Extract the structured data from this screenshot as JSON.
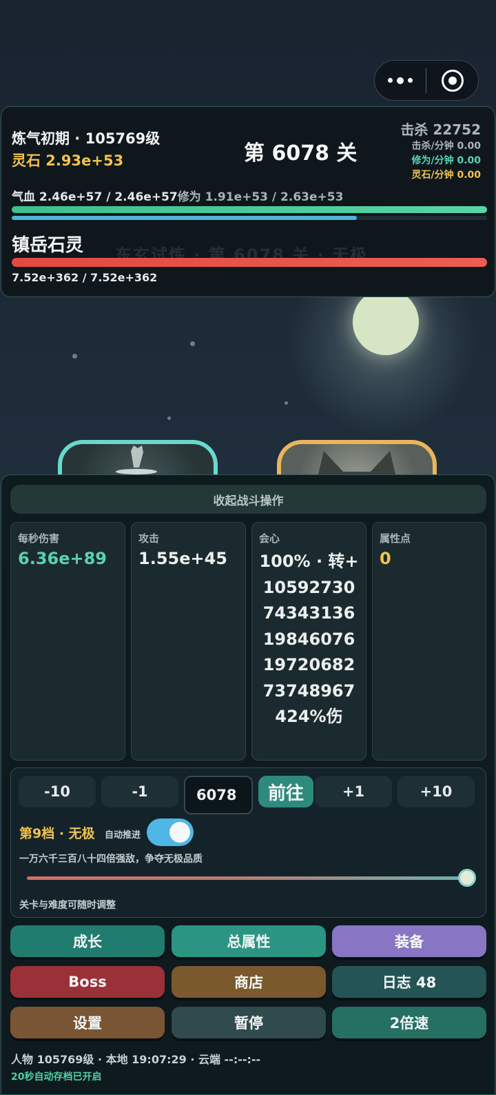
{
  "player": {
    "realm": "炼气初期 · 105769级",
    "stones": "灵石 2.93e+53",
    "hp_label": "气血 2.46e+57 / 2.46e+57",
    "cultivation_label": "修为 1.91e+53 / 2.63e+53",
    "hp_fraction": 1.0,
    "cultivation_fraction": 0.726
  },
  "stage": {
    "title": "第 6078 关"
  },
  "stats_header": {
    "kills": "击杀 22752",
    "kills_per_min": "击杀/分钟 0.00",
    "cultivation_per_min": "修为/分钟 0.00",
    "stones_per_min": "灵石/分钟 0.00"
  },
  "enemy": {
    "name": "镇岳石灵",
    "hp_label": "7.52e+362 / 7.52e+362",
    "hp_fraction": 1.0,
    "ghost_text": "东玄试炼 · 第 6078 关 · 无极"
  },
  "battle": {
    "collapse_label": "收起战斗操作",
    "dps_label": "每秒伤害",
    "dps_value": "6.36e+89",
    "attack_label": "攻击",
    "attack_value": "1.55e+45",
    "crit_label": "会心",
    "crit_value": "100% · 转+1059273074343136198460761972068273748967424%伤",
    "points_label": "属性点",
    "points_value": "0"
  },
  "stage_control": {
    "minus10": "-10",
    "minus1": "-1",
    "stage_input_value": "6078",
    "go_label": "前往",
    "plus1": "+1",
    "plus10": "+10",
    "tier_label": "第9档 · 无极",
    "autopush_label": "自动推进",
    "autopush_on": true,
    "difficulty_desc": "一万六千三百八十四倍强敌，争夺无极品质",
    "difficulty_fraction": 1.0,
    "hint": "关卡与难度可随时调整"
  },
  "menu": {
    "growth": "成长",
    "total_attrs": "总属性",
    "equipment": "装备",
    "boss": "Boss",
    "shop": "商店",
    "log": "日志 48",
    "settings": "设置",
    "pause": "暂停",
    "speed": "2倍速"
  },
  "colors": {
    "growth": "#217c70",
    "total_attrs": "#2c9483",
    "equipment": "#8876c4",
    "boss": "#9b3138",
    "shop": "#7a5a2c",
    "log": "#245456",
    "settings": "#7a5533",
    "pause": "#304a4d",
    "speed": "#257063",
    "accent_gold": "#f1c24c",
    "accent_teal": "#58d2b5"
  },
  "footer": {
    "status": "人物 105769级 · 本地 19:07:29 · 云端 --:--:--",
    "autosave": "20秒自动存档已开启"
  }
}
